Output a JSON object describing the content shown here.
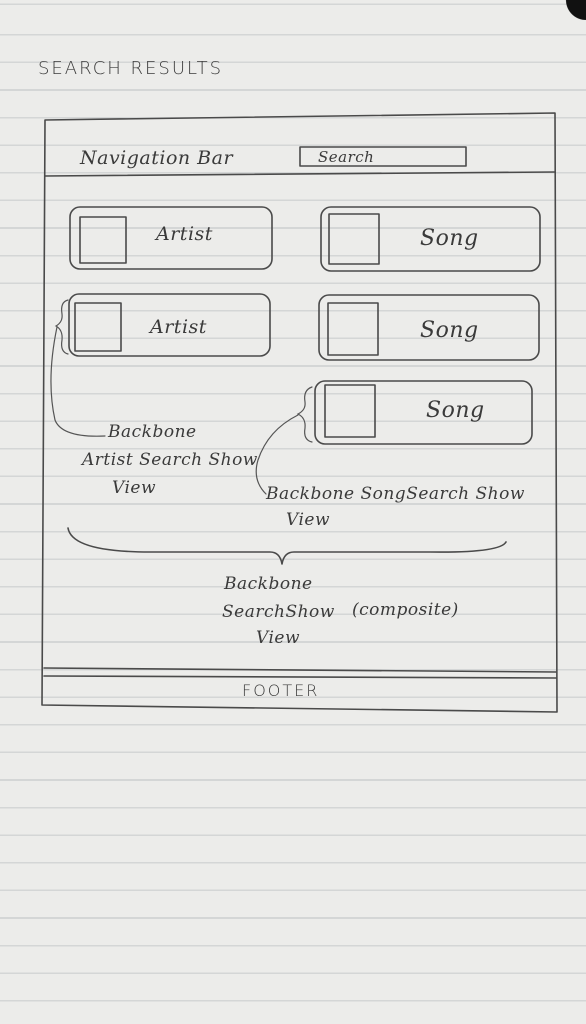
{
  "page_title": "Search Results",
  "navbar": {
    "label": "Navigation Bar",
    "search_label": "Search"
  },
  "results": {
    "artists": [
      {
        "label": "Artist"
      },
      {
        "label": "Artist"
      }
    ],
    "songs": [
      {
        "label": "Song"
      },
      {
        "label": "Song"
      },
      {
        "label": "Song"
      }
    ]
  },
  "annotations": {
    "artist_view": [
      "Backbone",
      "Artist Search Show",
      "View"
    ],
    "song_view": [
      "Backbone SongSearch Show",
      "View"
    ],
    "composite_view": [
      "Backbone",
      "SearchShow",
      "View"
    ],
    "composite_note": "(composite)"
  },
  "footer": {
    "label": "Footer"
  }
}
